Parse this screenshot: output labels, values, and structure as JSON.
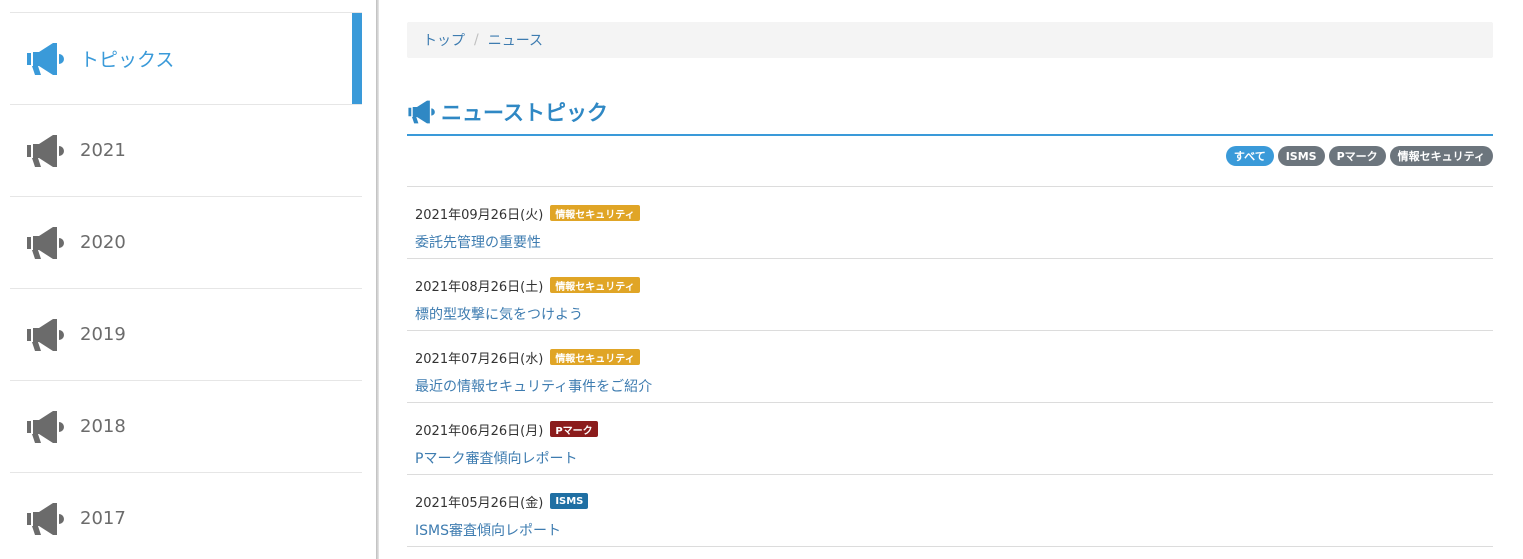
{
  "sidebar": {
    "items": [
      {
        "label": "トピックス",
        "active": true,
        "icon": "megaphone-icon"
      },
      {
        "label": "2021",
        "active": false,
        "icon": "megaphone-icon"
      },
      {
        "label": "2020",
        "active": false,
        "icon": "megaphone-icon"
      },
      {
        "label": "2019",
        "active": false,
        "icon": "megaphone-icon"
      },
      {
        "label": "2018",
        "active": false,
        "icon": "megaphone-icon"
      },
      {
        "label": "2017",
        "active": false,
        "icon": "megaphone-icon"
      }
    ]
  },
  "breadcrumb": {
    "home": "トップ",
    "separator": "/",
    "current": "ニュース"
  },
  "heading": {
    "title": "ニューストピック",
    "icon": "megaphone-icon"
  },
  "filters": {
    "all": "すべて",
    "isms": "ISMS",
    "pmark": "Pマーク",
    "security": "情報セキュリティ",
    "active": "all"
  },
  "news": [
    {
      "date": "2021年09月26日(火)",
      "tag": "情報セキュリティ",
      "tag_color": "#e0a526",
      "title": "委託先管理の重要性"
    },
    {
      "date": "2021年08月26日(土)",
      "tag": "情報セキュリティ",
      "tag_color": "#e0a526",
      "title": "標的型攻撃に気をつけよう"
    },
    {
      "date": "2021年07月26日(水)",
      "tag": "情報セキュリティ",
      "tag_color": "#e0a526",
      "title": "最近の情報セキュリティ事件をご紹介"
    },
    {
      "date": "2021年06月26日(月)",
      "tag": "Pマーク",
      "tag_color": "#8b1c1c",
      "title": "Pマーク審査傾向レポート"
    },
    {
      "date": "2021年05月26日(金)",
      "tag": "ISMS",
      "tag_color": "#1f6fa3",
      "title": "ISMS審査傾向レポート"
    }
  ],
  "colors": {
    "accent": "#3a9ad9",
    "link": "#3e7cb0",
    "icon_inactive": "#6b6b6b"
  }
}
